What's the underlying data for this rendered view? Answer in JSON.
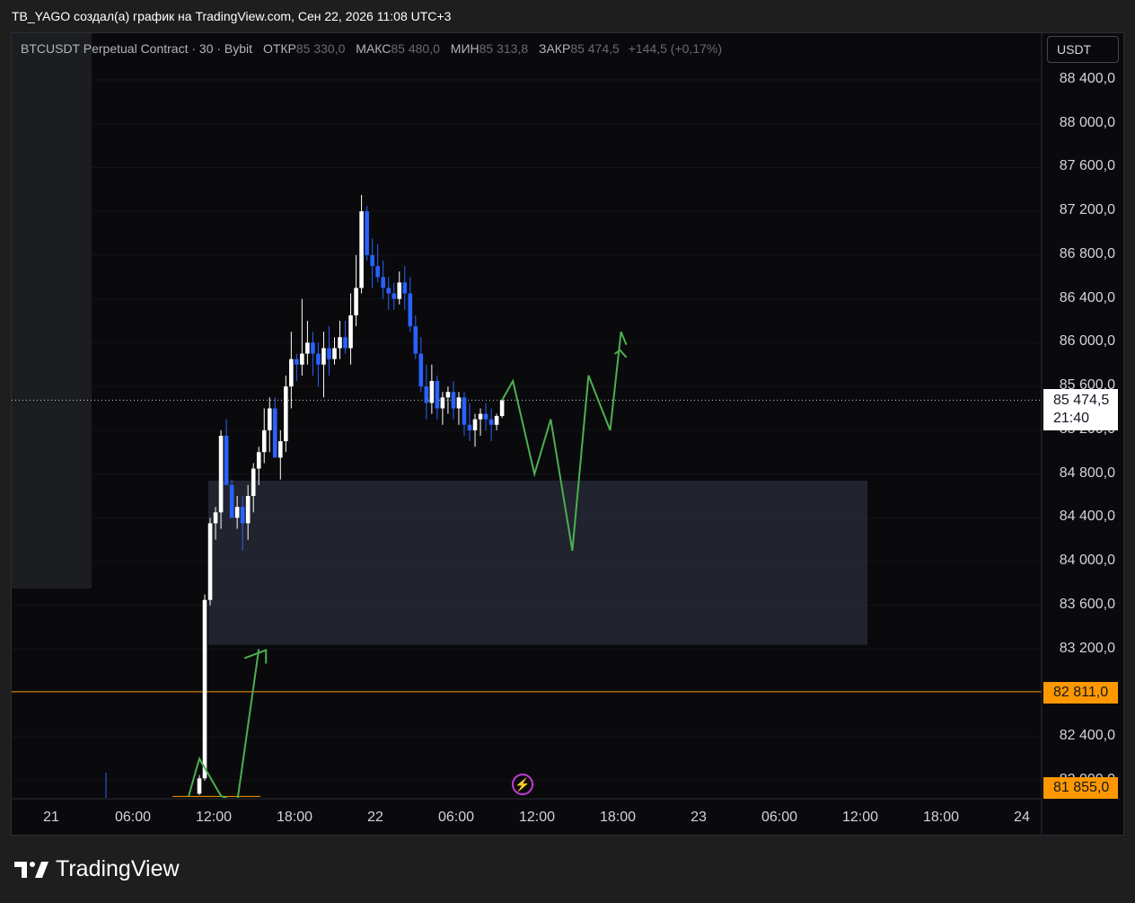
{
  "header": {
    "title": "TB_YAGO создал(а) график на TradingView.com, Сен 22, 2026 11:08 UTC+3"
  },
  "legend": {
    "symbol": "BTCUSDT Perpetual Contract · 30 · Bybit",
    "open_label": "ОТКР",
    "open": "85 330,0",
    "high_label": "МАКС",
    "high": "85 480,0",
    "low_label": "МИН",
    "low": "85 313,8",
    "close_label": "ЗАКР",
    "close": "85 474,5",
    "change": "+144,5 (+0,17%)"
  },
  "currency_button": "USDT",
  "last_price": {
    "value": "85 474,5",
    "countdown": "21:40"
  },
  "orange_tags": [
    "82 811,0",
    "81 855,0"
  ],
  "footer": {
    "brand": "TradingView"
  },
  "colors": {
    "up": "#ffffff",
    "down": "#2962ff",
    "arrow": "#4caf50",
    "level": "#ff9800",
    "zone": "#2a2e39"
  },
  "chart_data": {
    "type": "candlestick",
    "symbol": "BTCUSDT",
    "interval": "30",
    "ylim": [
      81800,
      88600
    ],
    "y_ticks": [
      "88 400,0",
      "88 000,0",
      "87 600,0",
      "87 200,0",
      "86 800,0",
      "86 400,0",
      "86 000,0",
      "85 600,0",
      "85 200,0",
      "84 800,0",
      "84 400,0",
      "84 000,0",
      "83 600,0",
      "83 200,0",
      "82 400,0",
      "82 000,0"
    ],
    "x_ticks": [
      "21",
      "06:00",
      "12:00",
      "18:00",
      "22",
      "06:00",
      "12:00",
      "18:00",
      "23",
      "06:00",
      "12:00",
      "18:00",
      "24"
    ],
    "candles": [
      [
        81880,
        82050,
        81870,
        82020
      ],
      [
        82020,
        83700,
        82000,
        83650
      ],
      [
        83650,
        84400,
        83600,
        84350
      ],
      [
        84350,
        84500,
        84200,
        84450
      ],
      [
        84450,
        85200,
        84300,
        85150
      ],
      [
        85150,
        85300,
        84750,
        84700
      ],
      [
        84700,
        84750,
        84450,
        84400
      ],
      [
        84400,
        84600,
        84300,
        84500
      ],
      [
        84500,
        84600,
        84100,
        84350
      ],
      [
        84350,
        84700,
        84200,
        84600
      ],
      [
        84600,
        84900,
        84450,
        84850
      ],
      [
        84850,
        85050,
        84700,
        85000
      ],
      [
        85000,
        85400,
        84900,
        85200
      ],
      [
        85200,
        85500,
        85000,
        85400
      ],
      [
        85400,
        85500,
        85000,
        84950
      ],
      [
        84950,
        85200,
        84750,
        85100
      ],
      [
        85100,
        85700,
        85000,
        85600
      ],
      [
        85600,
        86100,
        85400,
        85850
      ],
      [
        85850,
        85900,
        85650,
        85800
      ],
      [
        85800,
        86400,
        85700,
        85900
      ],
      [
        85900,
        86200,
        85800,
        86000
      ],
      [
        86000,
        86100,
        85700,
        85900
      ],
      [
        85900,
        86000,
        85600,
        85800
      ],
      [
        85800,
        86100,
        85500,
        85950
      ],
      [
        85950,
        86150,
        85700,
        85850
      ],
      [
        85850,
        86050,
        85800,
        85950
      ],
      [
        85950,
        86200,
        85850,
        86050
      ],
      [
        86050,
        86200,
        85900,
        85950
      ],
      [
        85950,
        86450,
        85800,
        86250
      ],
      [
        86250,
        86800,
        86150,
        86500
      ],
      [
        86500,
        87350,
        86450,
        87200
      ],
      [
        87200,
        87250,
        86750,
        86800
      ],
      [
        86800,
        86950,
        86500,
        86700
      ],
      [
        86700,
        86900,
        86550,
        86600
      ],
      [
        86600,
        86750,
        86400,
        86500
      ],
      [
        86500,
        86600,
        86300,
        86450
      ],
      [
        86450,
        86550,
        86300,
        86400
      ],
      [
        86400,
        86650,
        86350,
        86550
      ],
      [
        86550,
        86700,
        86300,
        86450
      ],
      [
        86450,
        86600,
        86100,
        86150
      ],
      [
        86150,
        86250,
        85850,
        85900
      ],
      [
        85900,
        86050,
        85550,
        85600
      ],
      [
        85600,
        85800,
        85300,
        85450
      ],
      [
        85450,
        85800,
        85350,
        85650
      ],
      [
        85650,
        85700,
        85300,
        85400
      ],
      [
        85400,
        85550,
        85250,
        85500
      ],
      [
        85500,
        85600,
        85350,
        85550
      ],
      [
        85550,
        85650,
        85300,
        85400
      ],
      [
        85400,
        85550,
        85250,
        85500
      ],
      [
        85500,
        85550,
        85150,
        85250
      ],
      [
        85250,
        85450,
        85100,
        85200
      ],
      [
        85200,
        85350,
        85050,
        85300
      ],
      [
        85300,
        85400,
        85150,
        85350
      ],
      [
        85350,
        85450,
        85200,
        85300
      ],
      [
        85300,
        85400,
        85100,
        85250
      ],
      [
        85250,
        85350,
        85200,
        85330
      ],
      [
        85330,
        85480,
        85313,
        85474
      ]
    ],
    "zone": {
      "x0_index": 1,
      "x1_index": 100,
      "y0": 83240,
      "y1": 84740
    },
    "horizontal_levels": [
      82811,
      81855
    ],
    "projection_path": [
      [
        56,
        85474
      ],
      [
        58,
        85650
      ],
      [
        62,
        84800
      ],
      [
        65,
        85300
      ],
      [
        69,
        84100
      ],
      [
        72,
        85700
      ],
      [
        76,
        85200
      ],
      [
        78,
        86100
      ],
      [
        79,
        85980
      ]
    ],
    "left_arrow": [
      [
        -2,
        81855
      ],
      [
        0,
        82200
      ],
      [
        4,
        81860
      ],
      [
        7,
        81800
      ],
      [
        11,
        83200
      ]
    ],
    "grid": true
  }
}
